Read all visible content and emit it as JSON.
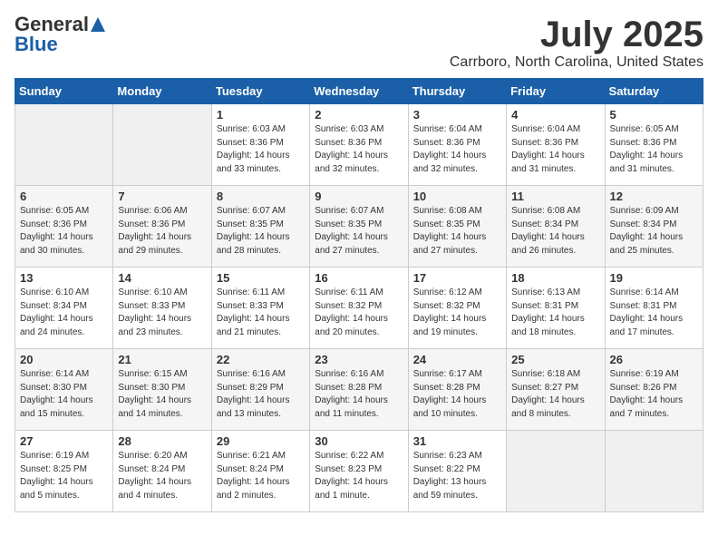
{
  "header": {
    "logo_general": "General",
    "logo_blue": "Blue",
    "month_title": "July 2025",
    "location": "Carrboro, North Carolina, United States"
  },
  "days_of_week": [
    "Sunday",
    "Monday",
    "Tuesday",
    "Wednesday",
    "Thursday",
    "Friday",
    "Saturday"
  ],
  "weeks": [
    [
      {
        "num": "",
        "info": ""
      },
      {
        "num": "",
        "info": ""
      },
      {
        "num": "1",
        "info": "Sunrise: 6:03 AM\nSunset: 8:36 PM\nDaylight: 14 hours and 33 minutes."
      },
      {
        "num": "2",
        "info": "Sunrise: 6:03 AM\nSunset: 8:36 PM\nDaylight: 14 hours and 32 minutes."
      },
      {
        "num": "3",
        "info": "Sunrise: 6:04 AM\nSunset: 8:36 PM\nDaylight: 14 hours and 32 minutes."
      },
      {
        "num": "4",
        "info": "Sunrise: 6:04 AM\nSunset: 8:36 PM\nDaylight: 14 hours and 31 minutes."
      },
      {
        "num": "5",
        "info": "Sunrise: 6:05 AM\nSunset: 8:36 PM\nDaylight: 14 hours and 31 minutes."
      }
    ],
    [
      {
        "num": "6",
        "info": "Sunrise: 6:05 AM\nSunset: 8:36 PM\nDaylight: 14 hours and 30 minutes."
      },
      {
        "num": "7",
        "info": "Sunrise: 6:06 AM\nSunset: 8:36 PM\nDaylight: 14 hours and 29 minutes."
      },
      {
        "num": "8",
        "info": "Sunrise: 6:07 AM\nSunset: 8:35 PM\nDaylight: 14 hours and 28 minutes."
      },
      {
        "num": "9",
        "info": "Sunrise: 6:07 AM\nSunset: 8:35 PM\nDaylight: 14 hours and 27 minutes."
      },
      {
        "num": "10",
        "info": "Sunrise: 6:08 AM\nSunset: 8:35 PM\nDaylight: 14 hours and 27 minutes."
      },
      {
        "num": "11",
        "info": "Sunrise: 6:08 AM\nSunset: 8:34 PM\nDaylight: 14 hours and 26 minutes."
      },
      {
        "num": "12",
        "info": "Sunrise: 6:09 AM\nSunset: 8:34 PM\nDaylight: 14 hours and 25 minutes."
      }
    ],
    [
      {
        "num": "13",
        "info": "Sunrise: 6:10 AM\nSunset: 8:34 PM\nDaylight: 14 hours and 24 minutes."
      },
      {
        "num": "14",
        "info": "Sunrise: 6:10 AM\nSunset: 8:33 PM\nDaylight: 14 hours and 23 minutes."
      },
      {
        "num": "15",
        "info": "Sunrise: 6:11 AM\nSunset: 8:33 PM\nDaylight: 14 hours and 21 minutes."
      },
      {
        "num": "16",
        "info": "Sunrise: 6:11 AM\nSunset: 8:32 PM\nDaylight: 14 hours and 20 minutes."
      },
      {
        "num": "17",
        "info": "Sunrise: 6:12 AM\nSunset: 8:32 PM\nDaylight: 14 hours and 19 minutes."
      },
      {
        "num": "18",
        "info": "Sunrise: 6:13 AM\nSunset: 8:31 PM\nDaylight: 14 hours and 18 minutes."
      },
      {
        "num": "19",
        "info": "Sunrise: 6:14 AM\nSunset: 8:31 PM\nDaylight: 14 hours and 17 minutes."
      }
    ],
    [
      {
        "num": "20",
        "info": "Sunrise: 6:14 AM\nSunset: 8:30 PM\nDaylight: 14 hours and 15 minutes."
      },
      {
        "num": "21",
        "info": "Sunrise: 6:15 AM\nSunset: 8:30 PM\nDaylight: 14 hours and 14 minutes."
      },
      {
        "num": "22",
        "info": "Sunrise: 6:16 AM\nSunset: 8:29 PM\nDaylight: 14 hours and 13 minutes."
      },
      {
        "num": "23",
        "info": "Sunrise: 6:16 AM\nSunset: 8:28 PM\nDaylight: 14 hours and 11 minutes."
      },
      {
        "num": "24",
        "info": "Sunrise: 6:17 AM\nSunset: 8:28 PM\nDaylight: 14 hours and 10 minutes."
      },
      {
        "num": "25",
        "info": "Sunrise: 6:18 AM\nSunset: 8:27 PM\nDaylight: 14 hours and 8 minutes."
      },
      {
        "num": "26",
        "info": "Sunrise: 6:19 AM\nSunset: 8:26 PM\nDaylight: 14 hours and 7 minutes."
      }
    ],
    [
      {
        "num": "27",
        "info": "Sunrise: 6:19 AM\nSunset: 8:25 PM\nDaylight: 14 hours and 5 minutes."
      },
      {
        "num": "28",
        "info": "Sunrise: 6:20 AM\nSunset: 8:24 PM\nDaylight: 14 hours and 4 minutes."
      },
      {
        "num": "29",
        "info": "Sunrise: 6:21 AM\nSunset: 8:24 PM\nDaylight: 14 hours and 2 minutes."
      },
      {
        "num": "30",
        "info": "Sunrise: 6:22 AM\nSunset: 8:23 PM\nDaylight: 14 hours and 1 minute."
      },
      {
        "num": "31",
        "info": "Sunrise: 6:23 AM\nSunset: 8:22 PM\nDaylight: 13 hours and 59 minutes."
      },
      {
        "num": "",
        "info": ""
      },
      {
        "num": "",
        "info": ""
      }
    ]
  ]
}
